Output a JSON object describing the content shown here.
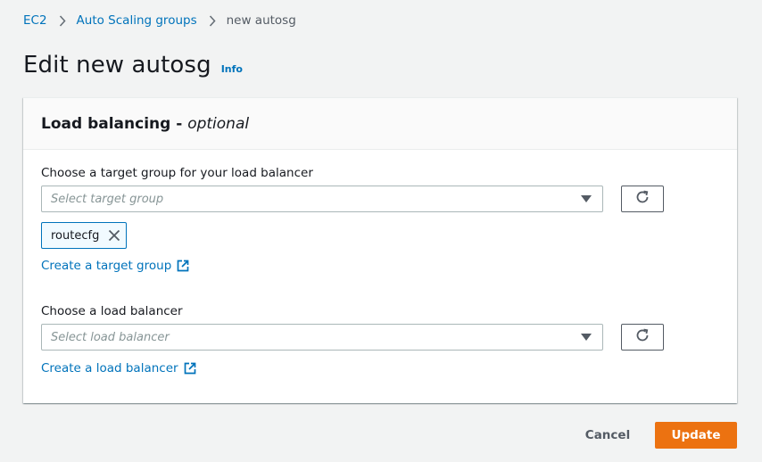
{
  "breadcrumb": {
    "items": [
      "EC2",
      "Auto Scaling groups"
    ],
    "current": "new autosg"
  },
  "page": {
    "title": "Edit new autosg",
    "info_label": "Info"
  },
  "panel": {
    "title": "Load balancing - ",
    "title_optional": "optional",
    "target_group": {
      "label": "Choose a target group for your load balancer",
      "placeholder": "Select target group",
      "selected_tokens": [
        "routecfg"
      ],
      "create_link": "Create a target group"
    },
    "load_balancer": {
      "label": "Choose a load balancer",
      "placeholder": "Select load balancer",
      "create_link": "Create a load balancer"
    }
  },
  "actions": {
    "cancel_label": "Cancel",
    "update_label": "Update"
  },
  "icons": {
    "breadcrumb_separator": "chevron-right-icon",
    "dropdown": "caret-down-icon",
    "refresh": "refresh-icon",
    "remove_token": "close-icon",
    "external_link": "external-link-icon"
  },
  "colors": {
    "link": "#0073bb",
    "primary_button": "#ec7211",
    "background": "#f2f3f3"
  }
}
